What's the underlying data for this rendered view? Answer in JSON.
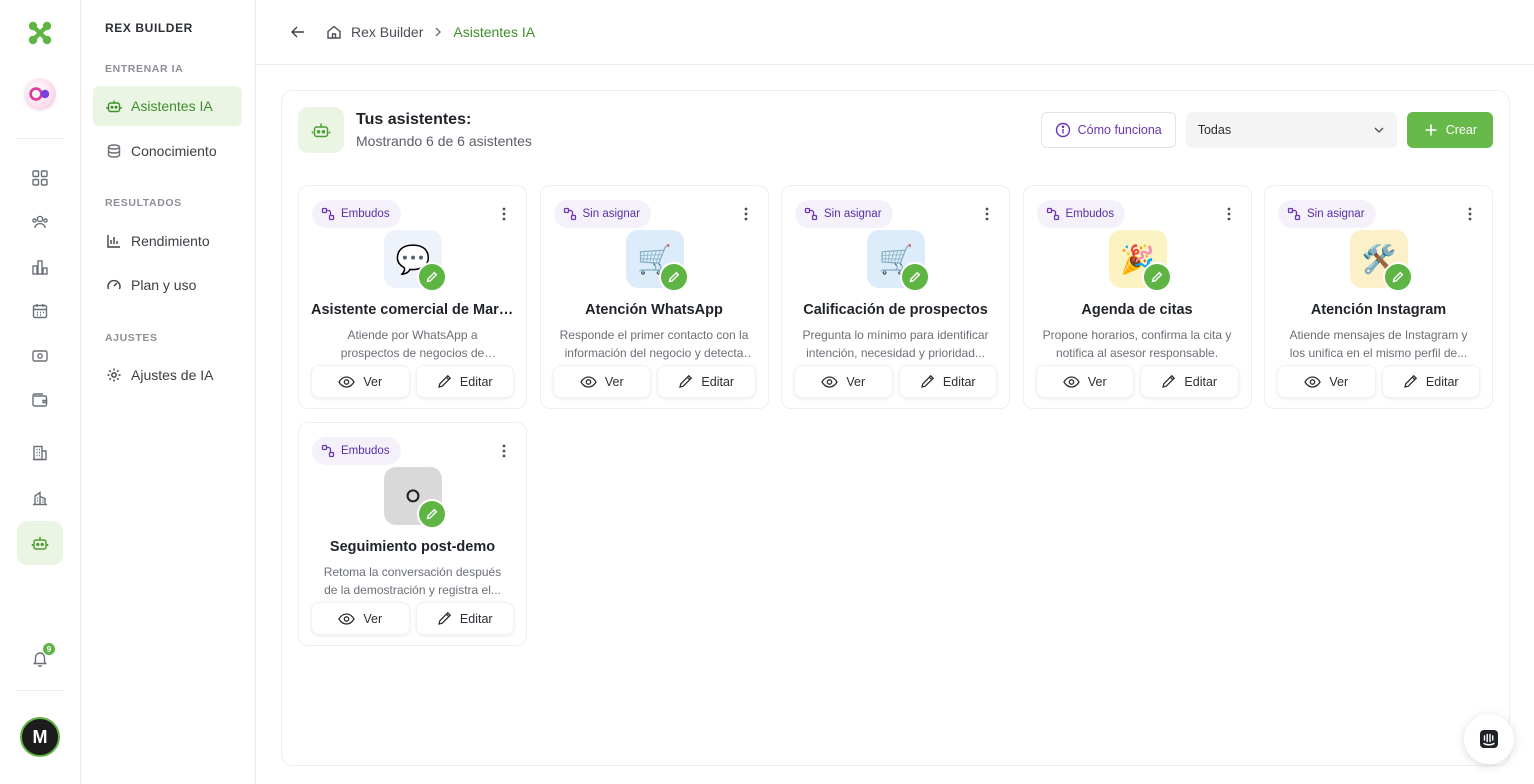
{
  "nav": {
    "brand": "REX BUILDER",
    "sections": [
      {
        "label": "ENTRENAR IA",
        "items": [
          {
            "label": "Asistentes IA",
            "icon": "robot-icon",
            "active": true
          },
          {
            "label": "Conocimiento",
            "icon": "database-icon",
            "active": false
          }
        ]
      },
      {
        "label": "RESULTADOS",
        "items": [
          {
            "label": "Rendimiento",
            "icon": "bar-chart-icon",
            "active": false
          },
          {
            "label": "Plan y uso",
            "icon": "gauge-icon",
            "active": false
          }
        ]
      },
      {
        "label": "AJUSTES",
        "items": [
          {
            "label": "Ajustes de IA",
            "icon": "gear-icon",
            "active": false
          }
        ]
      }
    ]
  },
  "rail": {
    "notifications_count": "9",
    "avatar_initial": "M"
  },
  "breadcrumb": {
    "root": "Rex Builder",
    "current": "Asistentes IA"
  },
  "panel": {
    "title": "Tus asistentes:",
    "subtitle": "Mostrando 6 de 6 asistentes",
    "how_label": "Cómo funciona",
    "filter_value": "Todas",
    "create_label": "Crear"
  },
  "assistants": [
    {
      "tag": "Embudos",
      "emoji": "💬",
      "bg": "#eef3fb",
      "name": "Asistente comercial de Martí...",
      "desc": "Atiende por WhatsApp a prospectos de negocios de servicios interesad..."
    },
    {
      "tag": "Sin asignar",
      "emoji": "🛒",
      "bg": "#dcecfb",
      "name": "Atención WhatsApp",
      "desc": "Responde el primer contacto con la información del negocio y detecta ..."
    },
    {
      "tag": "Sin asignar",
      "emoji": "🛒",
      "bg": "#dcecfb",
      "name": "Calificación de prospectos",
      "desc": "Pregunta lo mínimo para identificar intención, necesidad y prioridad..."
    },
    {
      "tag": "Embudos",
      "emoji": "🎉",
      "bg": "#fbf3c2",
      "name": "Agenda de citas",
      "desc": "Propone horarios, confirma la cita y notifica al asesor responsable."
    },
    {
      "tag": "Sin asignar",
      "emoji": "🛠️",
      "bg": "#fbf0c8",
      "name": "Atención Instagram",
      "desc": "Atiende mensajes de Instagram y los unifica en el mismo perfil de..."
    },
    {
      "tag": "Embudos",
      "emoji": "⚪",
      "bg": "#d9d9d9",
      "name": "Seguimiento post-demo",
      "desc": "Retoma la conversación después de la demostración y registra el..."
    }
  ],
  "card_actions": {
    "view": "Ver",
    "edit": "Editar"
  },
  "colors": {
    "accent": "#5fb544",
    "accent_bg": "#eaf5e3",
    "tag_text": "#5b2ea6",
    "tag_bg": "#f4f1fb"
  }
}
